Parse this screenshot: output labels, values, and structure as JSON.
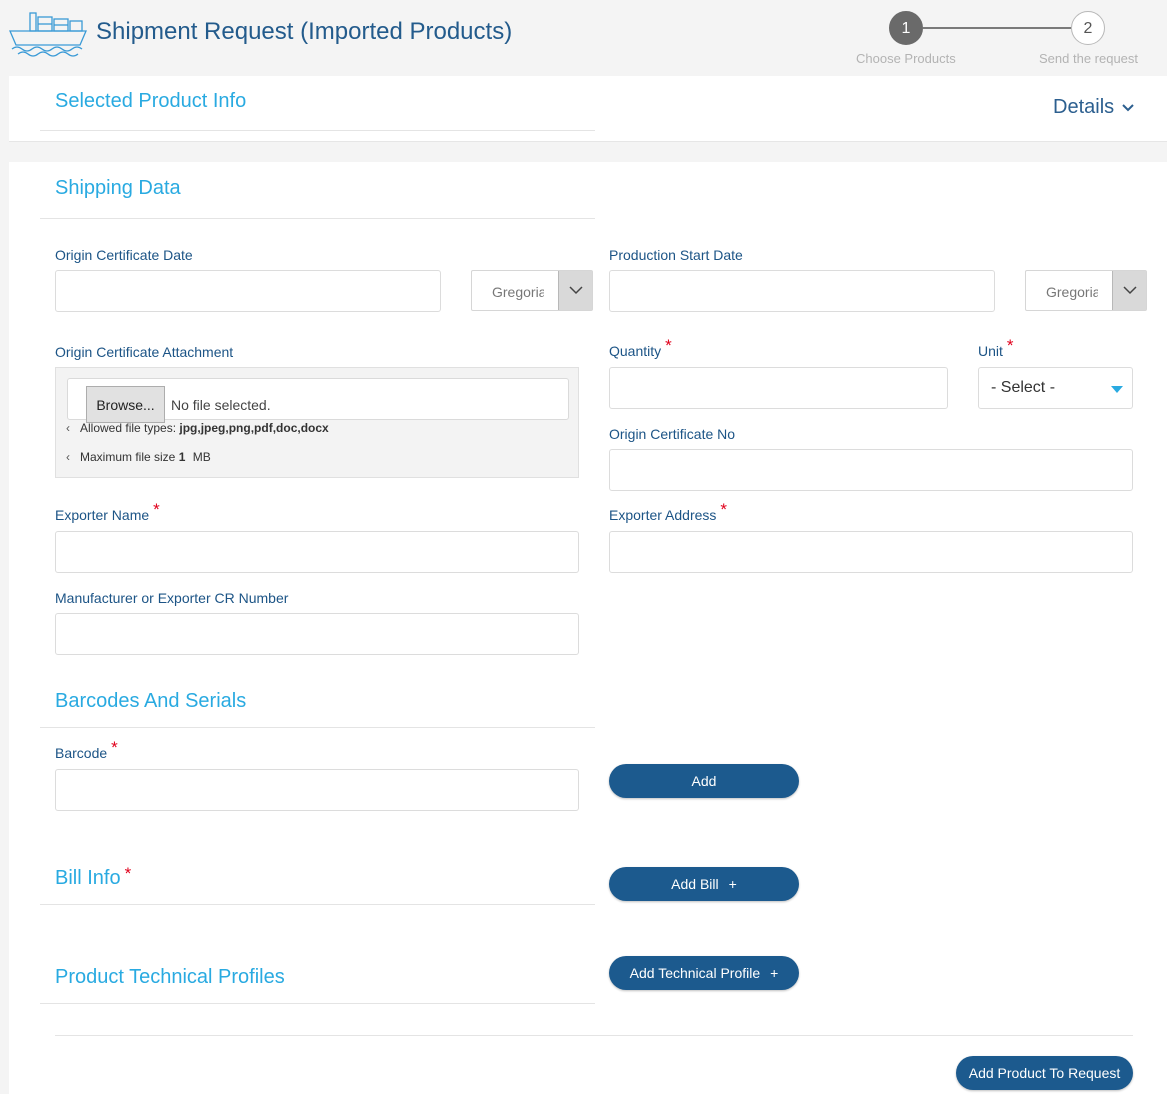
{
  "header": {
    "title": "Shipment Request (Imported Products)",
    "steps": [
      {
        "number": "1",
        "label": "Choose Products",
        "active": true
      },
      {
        "number": "2",
        "label": "Send the request",
        "active": false
      }
    ]
  },
  "selected_product": {
    "title": "Selected Product Info",
    "details_label": "Details"
  },
  "shipping": {
    "title": "Shipping Data",
    "origin_certificate_date": {
      "label": "Origin Certificate Date",
      "value": "",
      "calendar": "Gregorian"
    },
    "production_start_date": {
      "label": "Production Start Date",
      "value": "",
      "calendar": "Gregorian"
    },
    "origin_certificate_attachment": {
      "label": "Origin Certificate Attachment",
      "browse_label": "Browse...",
      "no_file_text": "No file selected.",
      "allowed_types_label": "Allowed file types:",
      "allowed_types": "jpg,jpeg,png,pdf,doc,docx",
      "max_size_label": "Maximum file size",
      "max_size_value": "1",
      "max_size_unit": "MB"
    },
    "quantity": {
      "label": "Quantity",
      "value": ""
    },
    "unit": {
      "label": "Unit",
      "selected": "- Select -"
    },
    "origin_certificate_no": {
      "label": "Origin Certificate No",
      "value": ""
    },
    "exporter_name": {
      "label": "Exporter Name",
      "value": ""
    },
    "exporter_address": {
      "label": "Exporter Address",
      "value": ""
    },
    "cr_number": {
      "label": "Manufacturer or Exporter CR Number",
      "value": ""
    }
  },
  "barcodes": {
    "title": "Barcodes And Serials",
    "barcode_label": "Barcode",
    "barcode_value": "",
    "add_label": "Add"
  },
  "bill": {
    "title": "Bill Info",
    "add_label": "Add Bill",
    "plus": "+"
  },
  "technical": {
    "title": "Product Technical Profiles",
    "add_label": "Add Technical Profile",
    "plus": "+"
  },
  "footer": {
    "add_product_label": "Add Product To Request"
  },
  "colors": {
    "accent": "#29aae1",
    "primary_button": "#1c5a8e",
    "label": "#1c5486",
    "required": "#e0001b"
  }
}
